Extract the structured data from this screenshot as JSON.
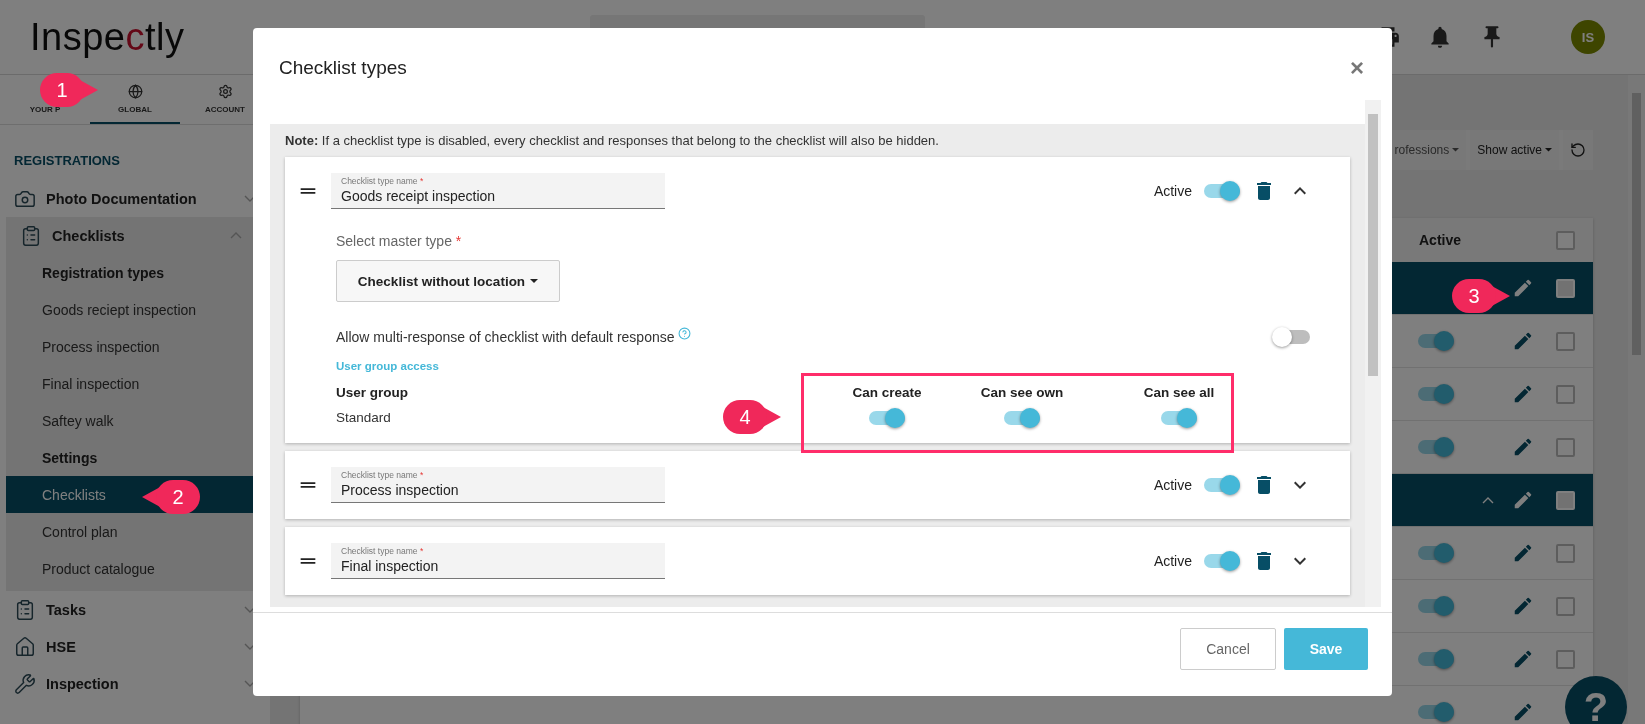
{
  "header": {
    "logo": {
      "before": "Inspe",
      "mark": "c",
      "after": "tly"
    },
    "avatar": "IS"
  },
  "sidebar": {
    "tabs": [
      {
        "label": "YOUR P",
        "selected": false
      },
      {
        "label": "GLOBAL",
        "selected": true
      },
      {
        "label": "ACCOUNT",
        "selected": false
      }
    ],
    "section": "REGISTRATIONS",
    "items": [
      {
        "label": "Photo Documentation",
        "expanded": false
      },
      {
        "label": "Checklists",
        "expanded": true,
        "children": [
          {
            "kind": "heading",
            "label": "Registration types"
          },
          {
            "kind": "link",
            "label": "Goods reciept inspection",
            "selected": false
          },
          {
            "kind": "link",
            "label": "Process inspection",
            "selected": false
          },
          {
            "kind": "link",
            "label": "Final inspection",
            "selected": false
          },
          {
            "kind": "link",
            "label": "Saftey walk",
            "selected": false
          },
          {
            "kind": "heading",
            "label": "Settings"
          },
          {
            "kind": "link",
            "label": "Checklists",
            "selected": true
          },
          {
            "kind": "link",
            "label": "Control plan",
            "selected": false
          },
          {
            "kind": "link",
            "label": "Product catalogue",
            "selected": false
          }
        ]
      },
      {
        "label": "Tasks",
        "expanded": false
      },
      {
        "label": "HSE",
        "expanded": false
      },
      {
        "label": "Inspection",
        "expanded": false
      }
    ]
  },
  "filters": [
    "rofessions",
    "Show active"
  ],
  "table": {
    "active_header": "Active",
    "header_checked": false,
    "rows": [
      {
        "kind": "group",
        "checked": false
      },
      {
        "kind": "item",
        "active": true,
        "checked": false
      },
      {
        "kind": "item",
        "active": true,
        "checked": false
      },
      {
        "kind": "item",
        "active": true,
        "checked": false
      },
      {
        "kind": "group",
        "expanded": true,
        "checked": false
      },
      {
        "kind": "item",
        "active": true,
        "checked": false
      },
      {
        "kind": "item",
        "active": true,
        "checked": false
      },
      {
        "kind": "item",
        "active": true,
        "checked": false
      },
      {
        "kind": "item",
        "active": true
      }
    ]
  },
  "help": "?",
  "modal": {
    "title": "Checklist types",
    "close": "×",
    "note": "**Note:** If a checklist type is disabled, every checklist and responses that belong to the checklist will also be hidden.",
    "types": [
      {
        "field_label": "Checklist type name",
        "required": "*",
        "name": "Goods receipt inspection",
        "active_label": "Active",
        "active": true,
        "expanded": true,
        "master_label": "Select master type",
        "master_required": "*",
        "master": "Checklist without location",
        "multi_label": "Allow multi-response of checklist with default response",
        "multi": false,
        "access_title": "User group access",
        "group_header": "User group",
        "permission_headers": [
          "Can create",
          "Can see own",
          "Can see all"
        ],
        "groups": [
          {
            "name": "Standard",
            "permissions": [
              true,
              true,
              true
            ]
          }
        ]
      },
      {
        "field_label": "Checklist type name",
        "required": "*",
        "name": "Process inspection",
        "active_label": "Active",
        "active": true,
        "expanded": false
      },
      {
        "field_label": "Checklist type name",
        "required": "*",
        "name": "Final inspection",
        "active_label": "Active",
        "active": true,
        "expanded": false
      }
    ],
    "cancel": "Cancel",
    "save": "Save"
  },
  "callouts": [
    {
      "number": "1"
    },
    {
      "number": "2"
    },
    {
      "number": "3"
    },
    {
      "number": "4"
    }
  ]
}
